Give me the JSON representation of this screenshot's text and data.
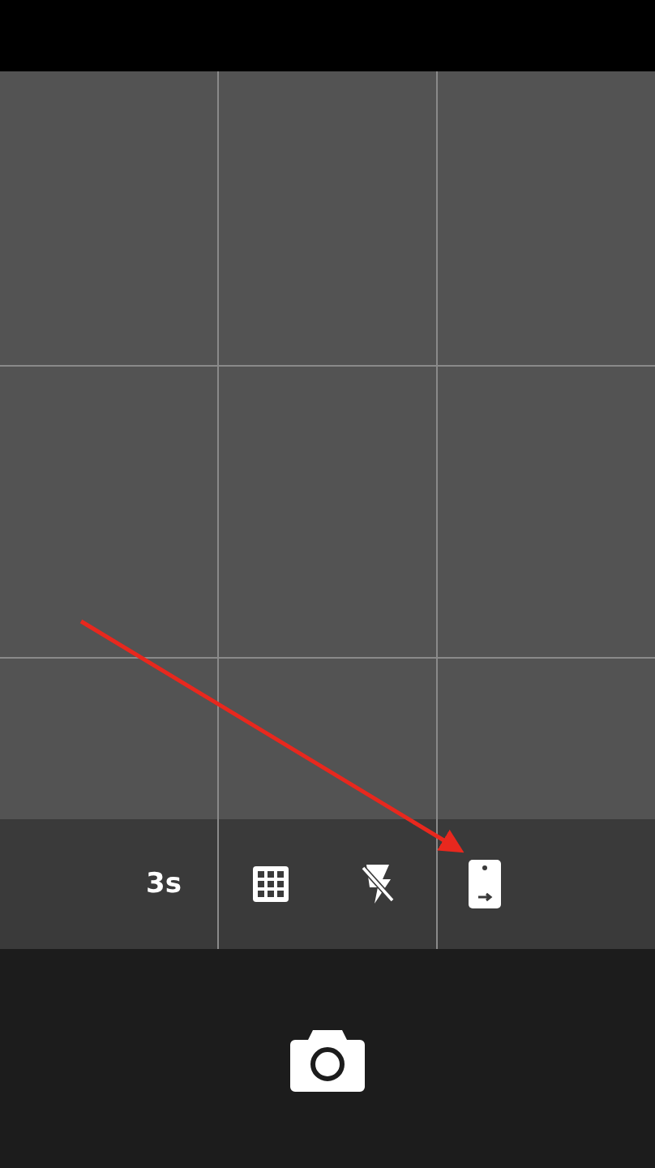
{
  "toolbar": [
    {
      "kind": "text",
      "label": "3s"
    },
    {
      "kind": "grid"
    },
    {
      "kind": "flash-off"
    },
    {
      "kind": "rotate"
    }
  ],
  "shutter": {
    "kind": "camera"
  }
}
